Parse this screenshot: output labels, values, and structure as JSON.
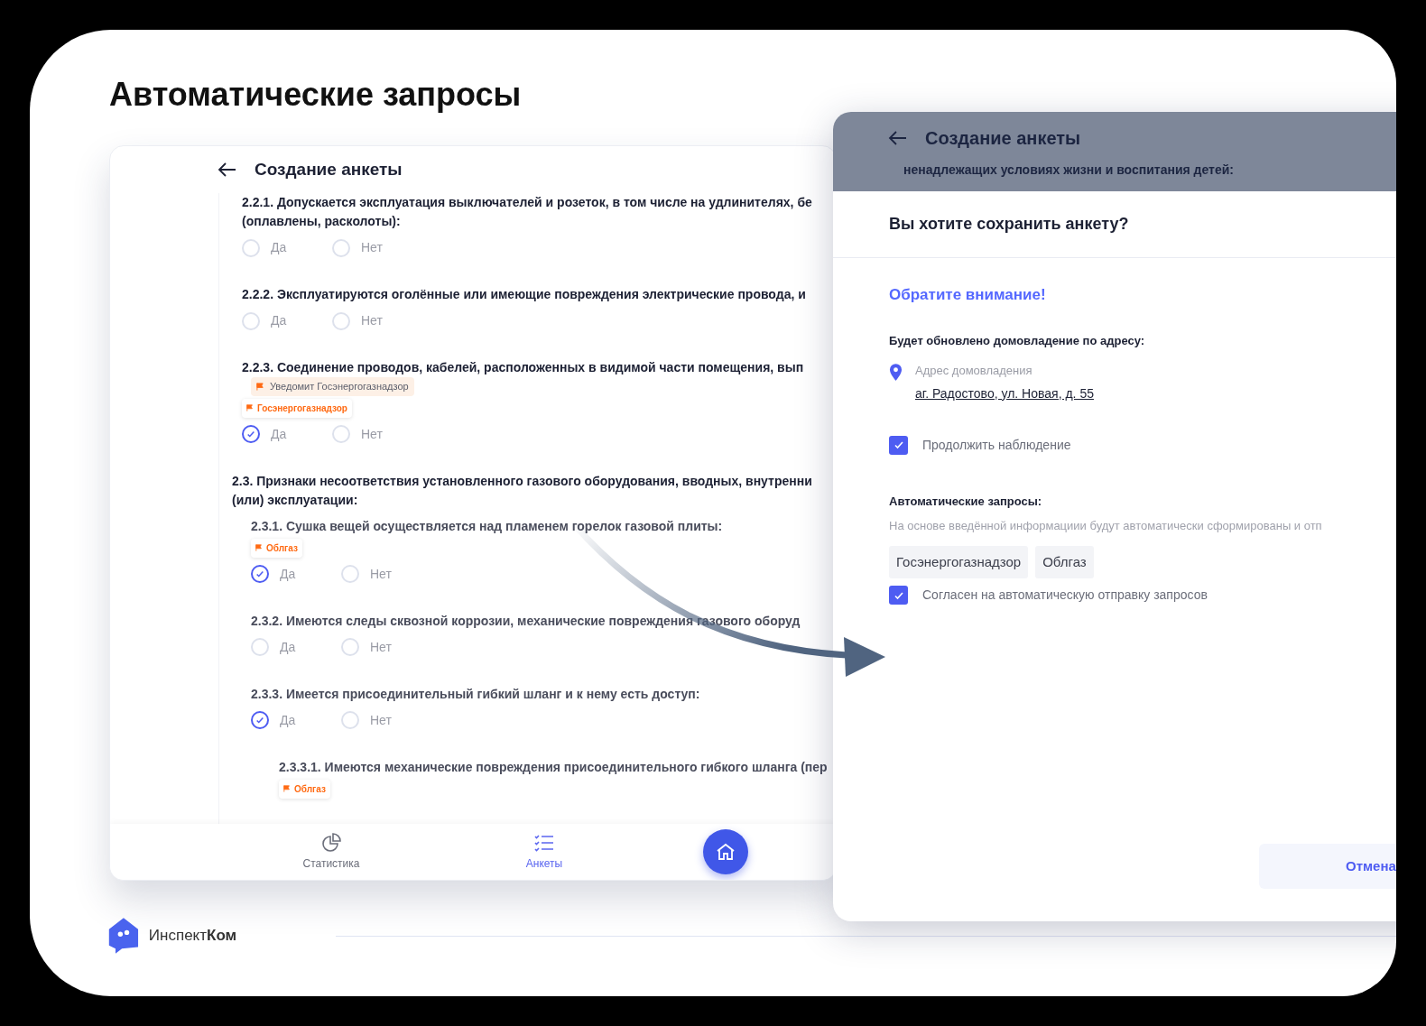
{
  "slide_title": "Автоматические запросы",
  "form_screen": {
    "title": "Создание анкеты",
    "items": [
      {
        "kind": "question",
        "lines": [
          "2.2.1. Допускается эксплуатация выключателей и розеток, в том числе на удлинителях, бе",
          "(оплавлены, расколоты):"
        ],
        "options": [
          {
            "label": "Да",
            "selected": false
          },
          {
            "label": "Нет",
            "selected": false
          }
        ]
      },
      {
        "kind": "question",
        "lines": [
          "2.2.2. Эксплуатируются оголённые или имеющие повреждения электрические провода, и"
        ],
        "options": [
          {
            "label": "Да",
            "selected": false
          },
          {
            "label": "Нет",
            "selected": false
          }
        ]
      },
      {
        "kind": "question",
        "lines": [
          "2.2.3. Соединение проводов, кабелей, расположенных в видимой части помещения, вып"
        ],
        "notice": "Уведомит Госэнергогазнадзор",
        "tags": [
          "Госэнергогазнадзор"
        ],
        "options": [
          {
            "label": "Да",
            "selected": true
          },
          {
            "label": "Нет",
            "selected": false
          }
        ]
      },
      {
        "kind": "section",
        "lines": [
          "2.3. Признаки несоответствия установленного газового оборудования, вводных, внутренни",
          "(или) эксплуатации:"
        ],
        "children": [
          {
            "kind": "question",
            "lines": [
              "2.3.1. Сушка вещей осуществляется над пламенем горелок газовой плиты:"
            ],
            "tags": [
              "Облгаз"
            ],
            "options": [
              {
                "label": "Да",
                "selected": true
              },
              {
                "label": "Нет",
                "selected": false
              }
            ]
          },
          {
            "kind": "question",
            "lines": [
              "2.3.2. Имеются следы сквозной коррозии, механические повреждения газового оборуд"
            ],
            "options": [
              {
                "label": "Да",
                "selected": false
              },
              {
                "label": "Нет",
                "selected": false
              }
            ]
          },
          {
            "kind": "question",
            "lines": [
              "2.3.3. Имеется присоединительный гибкий шланг и к нему есть доступ:"
            ],
            "options": [
              {
                "label": "Да",
                "selected": true
              },
              {
                "label": "Нет",
                "selected": false
              }
            ],
            "children": [
              {
                "kind": "question",
                "lines": [
                  "2.3.3.1. Имеются механические повреждения присоединительного гибкого шланга (пер"
                ],
                "tags": [
                  "Облгаз"
                ]
              }
            ]
          }
        ]
      }
    ],
    "nav": [
      {
        "kind": "stats",
        "label": "Статистика",
        "selected": false
      },
      {
        "kind": "forms",
        "label": "Анкеты",
        "selected": true
      },
      {
        "kind": "home",
        "selected": false
      }
    ]
  },
  "save_dialog": {
    "screen_title": "Создание анкеты",
    "screen_text": "ненадлежащих условиях жизни и воспитания детей:",
    "question": "Вы хотите сохранить анкету?",
    "attention": "Обратите внимание!",
    "address_heading": "Будет обновлено домовладение по адресу:",
    "address_caption": "Адрес домовладения",
    "address": "аг. Радостово, ул. Новая, д. 55",
    "continue": {
      "label": "Продолжить наблюдение",
      "checked": true
    },
    "auto_heading": "Автоматические запросы:",
    "auto_text": "На основе введённой информациии будут автоматически сформированы и отп",
    "recipients": [
      "Госэнергогазнадзор",
      "Облгаз"
    ],
    "consent": {
      "label": "Согласен на автоматическую отправку запросов",
      "checked": true
    },
    "cancel": "Отмена"
  },
  "brand": "Инспект**Ком**"
}
